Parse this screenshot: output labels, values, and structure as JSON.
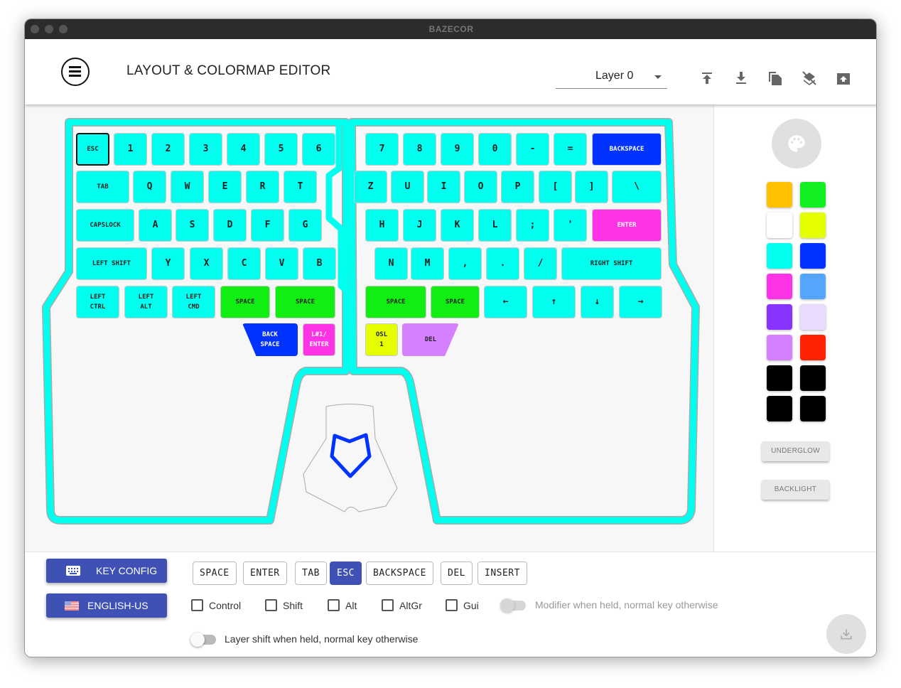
{
  "window": {
    "title": "BAZECOR"
  },
  "header": {
    "title": "LAYOUT & COLORMAP EDITOR",
    "layer": "Layer 0",
    "icons": [
      "upload-icon",
      "download-icon",
      "copy-icon",
      "clear-layer-icon",
      "import-export-icon"
    ]
  },
  "keyboard": {
    "colors": {
      "cyan": "#00ffee",
      "blue": "#0033ff",
      "magenta": "#ff33e6",
      "green": "#11ee11",
      "yellow": "#e6ff00",
      "lavender": "#d580ff"
    },
    "keys": [
      {
        "label": "ESC",
        "color": "cyan",
        "selected": true
      },
      {
        "label": "1",
        "color": "cyan"
      },
      {
        "label": "2",
        "color": "cyan"
      },
      {
        "label": "3",
        "color": "cyan"
      },
      {
        "label": "4",
        "color": "cyan"
      },
      {
        "label": "5",
        "color": "cyan"
      },
      {
        "label": "6",
        "color": "cyan"
      },
      {
        "label": "7",
        "color": "cyan"
      },
      {
        "label": "8",
        "color": "cyan"
      },
      {
        "label": "9",
        "color": "cyan"
      },
      {
        "label": "0",
        "color": "cyan"
      },
      {
        "label": "-",
        "color": "cyan"
      },
      {
        "label": "=",
        "color": "cyan"
      },
      {
        "label": "BACKSPACE",
        "color": "blue"
      },
      {
        "label": "TAB",
        "color": "cyan"
      },
      {
        "label": "Q",
        "color": "cyan"
      },
      {
        "label": "W",
        "color": "cyan"
      },
      {
        "label": "E",
        "color": "cyan"
      },
      {
        "label": "R",
        "color": "cyan"
      },
      {
        "label": "T",
        "color": "cyan"
      },
      {
        "label": "Z",
        "color": "cyan"
      },
      {
        "label": "U",
        "color": "cyan"
      },
      {
        "label": "I",
        "color": "cyan"
      },
      {
        "label": "O",
        "color": "cyan"
      },
      {
        "label": "P",
        "color": "cyan"
      },
      {
        "label": "[",
        "color": "cyan"
      },
      {
        "label": "]",
        "color": "cyan"
      },
      {
        "label": "\\",
        "color": "cyan"
      },
      {
        "label": "CAPSLOCK",
        "color": "cyan"
      },
      {
        "label": "A",
        "color": "cyan"
      },
      {
        "label": "S",
        "color": "cyan"
      },
      {
        "label": "D",
        "color": "cyan"
      },
      {
        "label": "F",
        "color": "cyan"
      },
      {
        "label": "G",
        "color": "cyan"
      },
      {
        "label": "H",
        "color": "cyan"
      },
      {
        "label": "J",
        "color": "cyan"
      },
      {
        "label": "K",
        "color": "cyan"
      },
      {
        "label": "L",
        "color": "cyan"
      },
      {
        "label": ";",
        "color": "cyan"
      },
      {
        "label": "'",
        "color": "cyan"
      },
      {
        "label": "ENTER",
        "color": "magenta"
      },
      {
        "label": "LEFT SHIFT",
        "color": "cyan"
      },
      {
        "label": "Y",
        "color": "cyan"
      },
      {
        "label": "X",
        "color": "cyan"
      },
      {
        "label": "C",
        "color": "cyan"
      },
      {
        "label": "V",
        "color": "cyan"
      },
      {
        "label": "B",
        "color": "cyan"
      },
      {
        "label": "N",
        "color": "cyan"
      },
      {
        "label": "M",
        "color": "cyan"
      },
      {
        "label": ",",
        "color": "cyan"
      },
      {
        "label": ".",
        "color": "cyan"
      },
      {
        "label": "/",
        "color": "cyan"
      },
      {
        "label": "RIGHT SHIFT",
        "color": "cyan"
      },
      {
        "label": "LEFT\nCTRL",
        "color": "cyan"
      },
      {
        "label": "LEFT\nALT",
        "color": "cyan"
      },
      {
        "label": "LEFT\nCMD",
        "color": "cyan"
      },
      {
        "label": "SPACE",
        "color": "green"
      },
      {
        "label": "SPACE",
        "color": "green"
      },
      {
        "label": "SPACE",
        "color": "green"
      },
      {
        "label": "SPACE",
        "color": "green"
      },
      {
        "label": "←",
        "color": "cyan"
      },
      {
        "label": "↑",
        "color": "cyan"
      },
      {
        "label": "↓",
        "color": "cyan"
      },
      {
        "label": "→",
        "color": "cyan"
      },
      {
        "label": "BACK\nSPACE",
        "color": "blue"
      },
      {
        "label": "L#1/\nENTER",
        "color": "magenta"
      },
      {
        "label": "OSL\n1",
        "color": "yellow"
      },
      {
        "label": "DEL",
        "color": "lavender"
      }
    ]
  },
  "palette": {
    "icon": "palette-icon",
    "colors": [
      "#ffc000",
      "#11ee22",
      "#ffffff",
      "#e6ff00",
      "#00ffee",
      "#0033ff",
      "#ff33e6",
      "#55a5ff",
      "#8833ff",
      "#eadcff",
      "#d580ff",
      "#ff2200",
      "#000000",
      "#000000",
      "#000000",
      "#000000"
    ],
    "underglow": "UNDERGLOW",
    "backlight": "BACKLIGHT"
  },
  "bottom": {
    "key_config": "KEY CONFIG",
    "language": "ENGLISH-US",
    "chips": [
      {
        "label": "SPACE"
      },
      {
        "label": "ENTER"
      },
      {
        "label": "TAB"
      },
      {
        "label": "ESC",
        "active": true
      },
      {
        "label": "BACKSPACE"
      },
      {
        "label": "DEL"
      },
      {
        "label": "INSERT"
      }
    ],
    "modifiers": [
      "Control",
      "Shift",
      "Alt",
      "AltGr",
      "Gui"
    ],
    "dual_function": "Modifier when held, normal key otherwise",
    "layer_shift": "Layer shift when held, normal key otherwise"
  }
}
